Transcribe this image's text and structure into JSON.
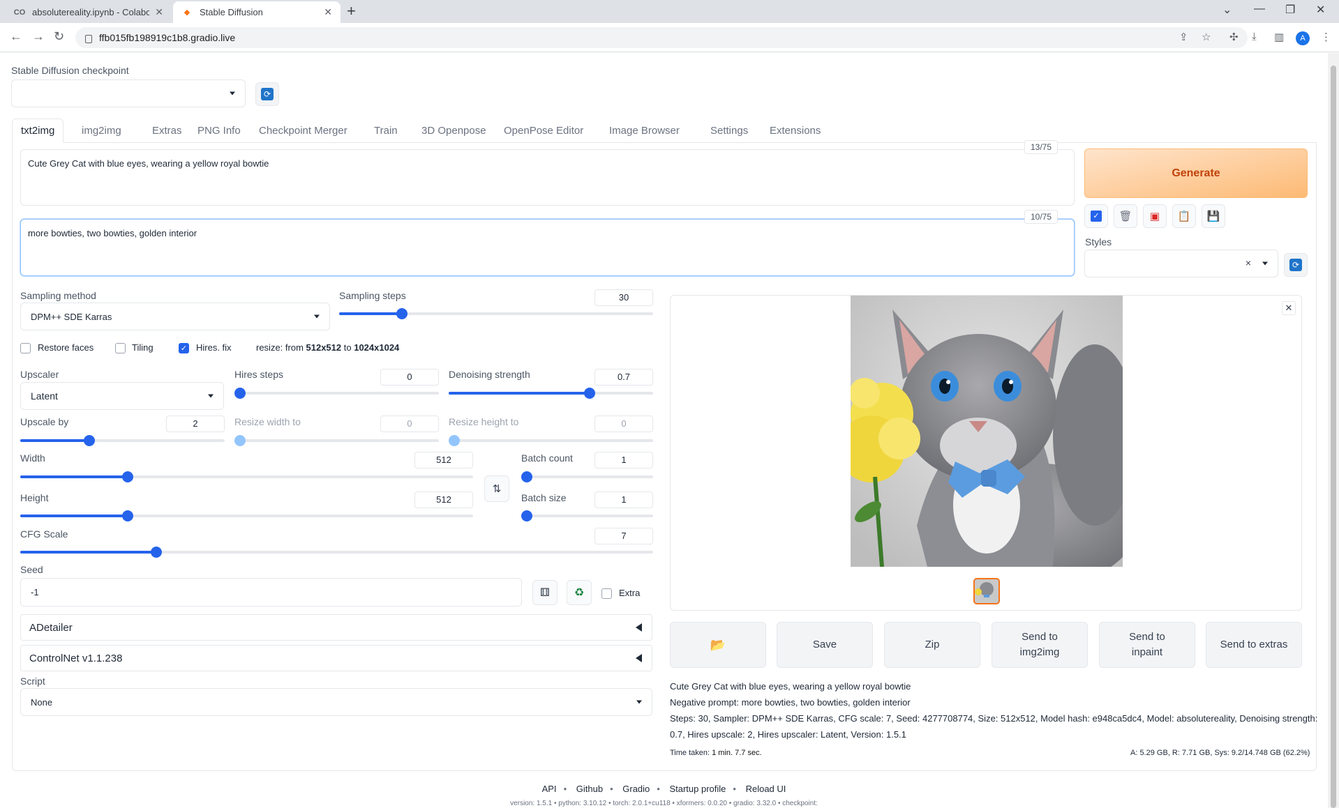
{
  "browser": {
    "tabs": [
      {
        "title": "absolutereality.ipynb - Colaborat",
        "icon": "colab-icon"
      },
      {
        "title": "Stable Diffusion",
        "icon": "gradio-icon"
      }
    ],
    "url": "ffb015fb198919c1b8.gradio.live",
    "avatar": "A"
  },
  "checkpoint": {
    "label": "Stable Diffusion checkpoint",
    "value": ""
  },
  "tabs": [
    "txt2img",
    "img2img",
    "Extras",
    "PNG Info",
    "Checkpoint Merger",
    "Train",
    "3D Openpose",
    "OpenPose Editor",
    "Image Browser",
    "Settings",
    "Extensions"
  ],
  "prompt": {
    "text": "Cute Grey Cat with blue eyes, wearing a yellow royal bowtie",
    "count": "13/75"
  },
  "negative": {
    "text": "more bowties, two bowties, golden  interior",
    "count": "10/75"
  },
  "generate_label": "Generate",
  "styles": {
    "label": "Styles",
    "clear": "×"
  },
  "sampling": {
    "method_label": "Sampling method",
    "method": "DPM++ SDE Karras",
    "steps_label": "Sampling steps",
    "steps": "30",
    "steps_fraction": 0.19
  },
  "checks": {
    "restore_faces": "Restore faces",
    "tiling": "Tiling",
    "hires_fix": "Hires. fix",
    "resize_prefix": "resize: from ",
    "resize_from": "512x512",
    "resize_mid": " to ",
    "resize_to": "1024x1024"
  },
  "hires": {
    "upscaler_label": "Upscaler",
    "upscaler": "Latent",
    "steps_label": "Hires steps",
    "steps": "0",
    "steps_fraction": 0.0,
    "denoise_label": "Denoising strength",
    "denoise": "0.7",
    "denoise_fraction": 0.7,
    "upscale_by_label": "Upscale by",
    "upscale_by": "2",
    "upscale_by_fraction": 0.33,
    "resize_w_label": "Resize width to",
    "resize_w": "0",
    "resize_h_label": "Resize height to",
    "resize_h": "0"
  },
  "size": {
    "width_label": "Width",
    "width": "512",
    "width_fraction": 0.23,
    "height_label": "Height",
    "height": "512",
    "height_fraction": 0.23,
    "batch_count_label": "Batch count",
    "batch_count": "1",
    "batch_size_label": "Batch size",
    "batch_size": "1"
  },
  "cfg": {
    "label": "CFG Scale",
    "value": "7",
    "fraction": 0.21
  },
  "seed": {
    "label": "Seed",
    "value": "-1",
    "extra": "Extra"
  },
  "accordions": [
    "ADetailer",
    "ControlNet v1.1.238"
  ],
  "script": {
    "label": "Script",
    "value": "None"
  },
  "output_buttons": {
    "save": "Save",
    "zip": "Zip",
    "img2img": "Send to\nimg2img",
    "inpaint": "Send to\ninpaint",
    "extras": "Send to extras"
  },
  "info": {
    "prompt": "Cute Grey Cat with blue eyes, wearing a yellow royal bowtie",
    "negative": "Negative prompt: more bowties, two bowties, golden interior",
    "params1": "Steps: 30, Sampler: DPM++ SDE Karras, CFG scale: 7, Seed: 4277708774, Size: 512x512, Model hash: e948ca5dc4, Model: absolutereality, Denoising strength:",
    "params2": "0.7, Hires upscale: 2, Hires upscaler: Latent, Version: 1.5.1",
    "time_label": "Time taken: ",
    "time": "1 min. 7.7 sec.",
    "mem_a_label": "A: ",
    "mem_a": "5.29 GB",
    "mem_r_label": ", R: ",
    "mem_r": "7.71 GB",
    "mem_sys_label": ", Sys: ",
    "mem_sys": "9.2/14.748 GB",
    "mem_pct": " (62.2%)"
  },
  "footer": {
    "links": [
      "API",
      "Github",
      "Gradio",
      "Startup profile",
      "Reload UI"
    ],
    "version": "version: 1.5.1  •  python: 3.10.12  •  torch: 2.0.1+cu118  •  xformers: 0.0.20  •  gradio: 3.32.0  •  checkpoint:"
  }
}
